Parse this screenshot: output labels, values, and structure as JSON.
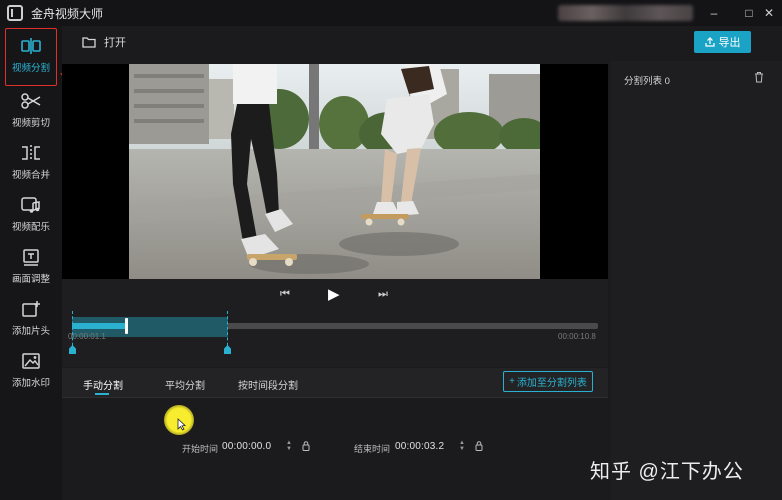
{
  "app": {
    "title": "金舟视频大师"
  },
  "window": {
    "minimize": "–",
    "maximize": "□",
    "close": "✕"
  },
  "sidebar": {
    "items": [
      {
        "label": "视频分割",
        "icon": "split-icon",
        "active": true
      },
      {
        "label": "视频剪切",
        "icon": "scissors-icon"
      },
      {
        "label": "视频合并",
        "icon": "merge-icon"
      },
      {
        "label": "视频配乐",
        "icon": "music-note-icon"
      },
      {
        "label": "画面调整",
        "icon": "crop-icon"
      },
      {
        "label": "添加片头",
        "icon": "add-intro-icon"
      },
      {
        "label": "添加水印",
        "icon": "watermark-icon"
      }
    ]
  },
  "toolbar": {
    "open_label": "打开",
    "export_label": "导出"
  },
  "playback": {
    "rewind": "⏮",
    "play": "▶",
    "forward": "⏭"
  },
  "timeline": {
    "start_time": "00:00:01.1",
    "end_time": "00:00:10.8"
  },
  "split_tabs": [
    {
      "label": "手动分割",
      "active": true
    },
    {
      "label": "平均分割"
    },
    {
      "label": "按时间段分割"
    }
  ],
  "add_to_list_label": "添加至分割列表",
  "start": {
    "label": "开始时间",
    "value": "00:00:00.0"
  },
  "end": {
    "label": "结束时间",
    "value": "00:00:03.2"
  },
  "right_panel": {
    "title": "分割列表 0"
  },
  "watermark": "知乎 @江下办公",
  "colors": {
    "accent": "#2ab1d0",
    "export_bg": "#1aa3c5",
    "highlight": "#e0302c"
  }
}
